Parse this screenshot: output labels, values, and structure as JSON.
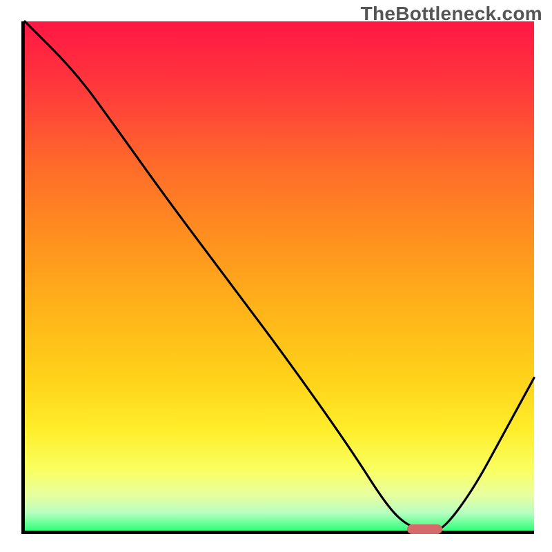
{
  "watermark": "TheBottleneck.com",
  "chart_data": {
    "type": "line",
    "title": "",
    "xlabel": "",
    "ylabel": "",
    "xlim": [
      0,
      100
    ],
    "ylim": [
      0,
      100
    ],
    "grid": false,
    "legend": false,
    "gradient_stops": [
      {
        "offset": 0.0,
        "color": "#ff1744"
      },
      {
        "offset": 0.14,
        "color": "#ff3b3b"
      },
      {
        "offset": 0.28,
        "color": "#ff6a2a"
      },
      {
        "offset": 0.42,
        "color": "#ff8f1f"
      },
      {
        "offset": 0.56,
        "color": "#ffb21a"
      },
      {
        "offset": 0.7,
        "color": "#ffd21a"
      },
      {
        "offset": 0.8,
        "color": "#ffed2a"
      },
      {
        "offset": 0.88,
        "color": "#faff60"
      },
      {
        "offset": 0.93,
        "color": "#e8ffa0"
      },
      {
        "offset": 0.965,
        "color": "#b8ffc0"
      },
      {
        "offset": 1.0,
        "color": "#2eff7a"
      }
    ],
    "series": [
      {
        "name": "bottleneck-curve",
        "x": [
          0,
          10,
          18,
          28,
          40,
          52,
          64,
          71,
          75,
          79,
          82,
          88,
          94,
          100
        ],
        "y": [
          100,
          90,
          79,
          65,
          49,
          33,
          16,
          5,
          1,
          0,
          0,
          8,
          19,
          30
        ]
      }
    ],
    "marker": {
      "x_start": 75,
      "x_end": 82,
      "y": 0,
      "color": "#d46a6a"
    }
  }
}
